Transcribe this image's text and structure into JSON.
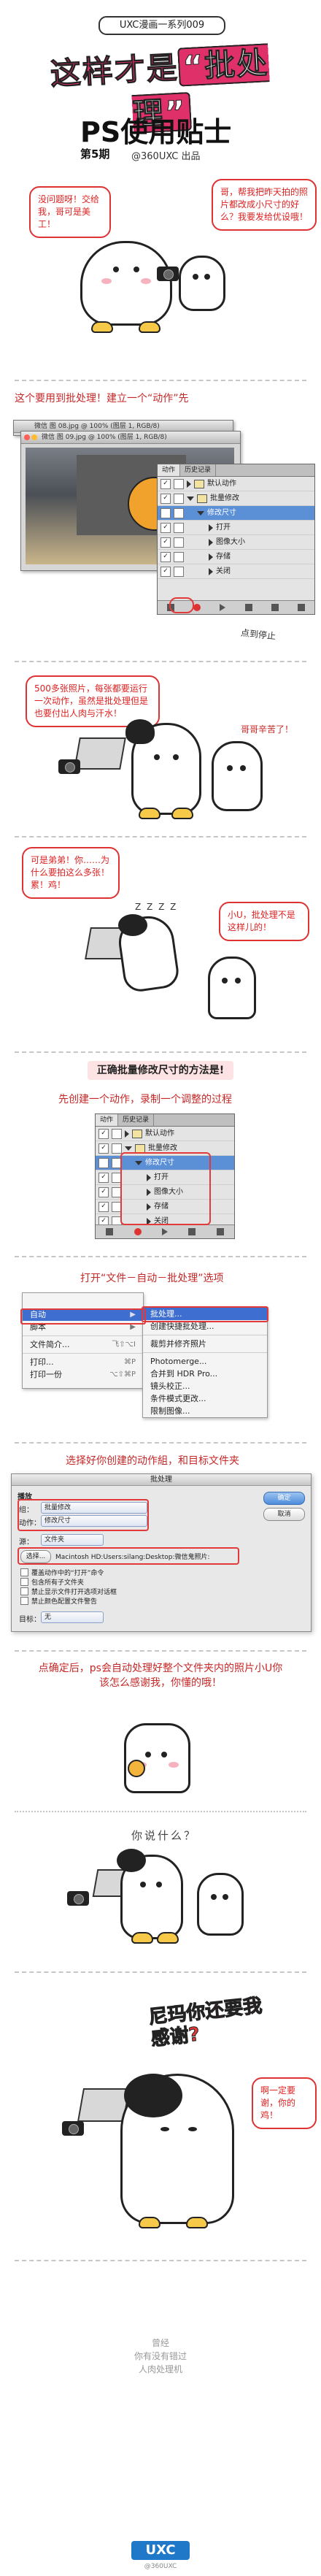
{
  "header": {
    "series_tag": "UXC漫画一系列009",
    "title_pre": "这样才是",
    "title_quote": "“批处理”",
    "subtitle": "PS使用贴士",
    "episode": "第5期",
    "credit": "@360UXC 出品"
  },
  "panel1": {
    "left_bubble": "没问题呀！交给我，哥可是美工！",
    "right_bubble": "哥，帮我把昨天拍的照片都改成小尺寸的好么？我要发给优设哦！"
  },
  "panel2": {
    "caption": "这个要用到批处理！建立一个“动作”先",
    "window_title": "微信 图 09.jpg @ 100% (图层 1, RGB/8)",
    "window_title_back": "微信 图 08.jpg @ 100% (图层 1, RGB/8)",
    "actions_panel": {
      "tabs": [
        "动作",
        "历史记录"
      ],
      "rows": [
        "默认动作",
        "批量修改",
        "修改尺寸",
        "打开",
        "图像大小",
        "存储",
        "关闭"
      ]
    },
    "note": "点到停止"
  },
  "panel3": {
    "bubble": "500多张照片，每张都要运行一次动作，虽然是批处理但是也要付出人肉与汗水！",
    "reply": "哥哥辛苦了！"
  },
  "panel4": {
    "bubble_left": "可是弟弟！你……为什么要拍这么多张！累！鸡！",
    "zzz": "Z Z Z Z",
    "bubble_right": "小U，批处理不是这样儿的！"
  },
  "panel5": {
    "title": "正确批量修改尺寸的方法是!",
    "caption": "先创建一个动作，录制一个调整的过程",
    "actions_panel": {
      "tabs": [
        "动作",
        "历史记录"
      ],
      "rows": [
        "默认动作",
        "批量修改",
        "修改尺寸",
        "打开",
        "图像大小",
        "存储",
        "关闭"
      ]
    }
  },
  "panel6": {
    "caption": "打开“文件－自动－批处理”选项",
    "menu_left": [
      "自动",
      "脚本",
      "文件简介...",
      "打印...",
      "打印一份"
    ],
    "menu_left_keys": [
      "",
      "",
      "飞⇧⌥I",
      "⌘P",
      "⌥⇧⌘P"
    ],
    "menu_right": [
      "批处理...",
      "创建快捷批处理...",
      "裁剪并修齐照片",
      "Photomerge...",
      "合并到 HDR Pro...",
      "镜头校正...",
      "条件模式更改...",
      "限制图像..."
    ]
  },
  "panel7": {
    "caption": "选择好你创建的动作組，和目标文件夹",
    "dialog_title": "批处理",
    "play_label": "播放",
    "set_label": "组：",
    "set_value": "批量修改",
    "action_label": "动作：",
    "action_value": "修改尺寸",
    "source_label": "源：",
    "source_value": "文件夹",
    "choose_button": "选择...",
    "path": "Macintosh HD:Users:silang:Desktop:微信鬼照片:",
    "options": [
      "覆盖动作中的“打开”命令",
      "包含所有子文件夹",
      "禁止显示文件打开选项对话框",
      "禁止颜色配置文件警告"
    ],
    "dest_label": "目标：",
    "dest_value": "无",
    "ok_button": "确定",
    "cancel_button": "取消"
  },
  "panel8": {
    "bubble": "点确定后，ps会自动处理好整个文件夹内的照片小U你该怎么感谢我，你懂的哦！",
    "question": "你说什么？"
  },
  "panel9": {
    "shout": "尼玛你还要我感谢?",
    "bubble": "啊一定要谢，你的鸡！"
  },
  "footer": {
    "lines": [
      "曾经",
      "你有没有错过",
      "人肉处理机"
    ],
    "logo": "UXC",
    "copyright": "@360UXC"
  }
}
